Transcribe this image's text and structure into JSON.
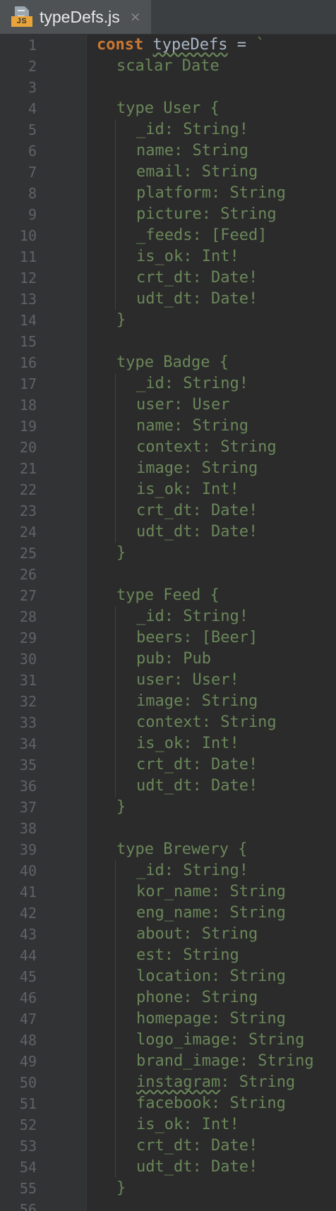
{
  "tab": {
    "icon": "js-file-icon",
    "badge": "JS",
    "title": "typeDefs.js",
    "close": "×"
  },
  "editor": {
    "lines": [
      {
        "n": "1",
        "indent": 0,
        "kw": "const",
        "id": "typeDefs",
        "op": " = ",
        "text": "`"
      },
      {
        "n": "2",
        "indent": 1,
        "text": "scalar Date"
      },
      {
        "n": "3",
        "indent": 0,
        "text": ""
      },
      {
        "n": "4",
        "indent": 1,
        "text": "type User {"
      },
      {
        "n": "5",
        "indent": 2,
        "text": "_id: String!"
      },
      {
        "n": "6",
        "indent": 2,
        "text": "name: String"
      },
      {
        "n": "7",
        "indent": 2,
        "text": "email: String"
      },
      {
        "n": "8",
        "indent": 2,
        "text": "platform: String"
      },
      {
        "n": "9",
        "indent": 2,
        "text": "picture: String"
      },
      {
        "n": "10",
        "indent": 2,
        "text": "_feeds: [Feed]"
      },
      {
        "n": "11",
        "indent": 2,
        "text": "is_ok: Int!"
      },
      {
        "n": "12",
        "indent": 2,
        "text": "crt_dt: Date!"
      },
      {
        "n": "13",
        "indent": 2,
        "text": "udt_dt: Date!"
      },
      {
        "n": "14",
        "indent": 1,
        "text": "}"
      },
      {
        "n": "15",
        "indent": 0,
        "text": ""
      },
      {
        "n": "16",
        "indent": 1,
        "text": "type Badge {"
      },
      {
        "n": "17",
        "indent": 2,
        "text": "_id: String!"
      },
      {
        "n": "18",
        "indent": 2,
        "text": "user: User"
      },
      {
        "n": "19",
        "indent": 2,
        "text": "name: String"
      },
      {
        "n": "20",
        "indent": 2,
        "text": "context: String"
      },
      {
        "n": "21",
        "indent": 2,
        "text": "image: String"
      },
      {
        "n": "22",
        "indent": 2,
        "text": "is_ok: Int!"
      },
      {
        "n": "23",
        "indent": 2,
        "text": "crt_dt: Date!"
      },
      {
        "n": "24",
        "indent": 2,
        "text": "udt_dt: Date!"
      },
      {
        "n": "25",
        "indent": 1,
        "text": "}"
      },
      {
        "n": "26",
        "indent": 0,
        "text": ""
      },
      {
        "n": "27",
        "indent": 1,
        "text": "type Feed {"
      },
      {
        "n": "28",
        "indent": 2,
        "text": "_id: String!"
      },
      {
        "n": "29",
        "indent": 2,
        "text": "beers: [Beer]"
      },
      {
        "n": "30",
        "indent": 2,
        "text": "pub: Pub"
      },
      {
        "n": "31",
        "indent": 2,
        "text": "user: User!"
      },
      {
        "n": "32",
        "indent": 2,
        "text": "image: String"
      },
      {
        "n": "33",
        "indent": 2,
        "text": "context: String"
      },
      {
        "n": "34",
        "indent": 2,
        "text": "is_ok: Int!"
      },
      {
        "n": "35",
        "indent": 2,
        "text": "crt_dt: Date!"
      },
      {
        "n": "36",
        "indent": 2,
        "text": "udt_dt: Date!"
      },
      {
        "n": "37",
        "indent": 1,
        "text": "}"
      },
      {
        "n": "38",
        "indent": 0,
        "text": ""
      },
      {
        "n": "39",
        "indent": 1,
        "text": "type Brewery {"
      },
      {
        "n": "40",
        "indent": 2,
        "text": "_id: String!"
      },
      {
        "n": "41",
        "indent": 2,
        "text": "kor_name: String"
      },
      {
        "n": "42",
        "indent": 2,
        "text": "eng_name: String"
      },
      {
        "n": "43",
        "indent": 2,
        "text": "about: String"
      },
      {
        "n": "44",
        "indent": 2,
        "text": "est: String"
      },
      {
        "n": "45",
        "indent": 2,
        "text": "location: String"
      },
      {
        "n": "46",
        "indent": 2,
        "text": "phone: String"
      },
      {
        "n": "47",
        "indent": 2,
        "text": "homepage: String"
      },
      {
        "n": "48",
        "indent": 2,
        "text": "logo_image: String"
      },
      {
        "n": "49",
        "indent": 2,
        "text": "brand_image: String"
      },
      {
        "n": "50",
        "indent": 2,
        "text": "instagram: String"
      },
      {
        "n": "51",
        "indent": 2,
        "text": "facebook: String"
      },
      {
        "n": "52",
        "indent": 2,
        "text": "is_ok: Int!"
      },
      {
        "n": "53",
        "indent": 2,
        "text": "crt_dt: Date!"
      },
      {
        "n": "54",
        "indent": 2,
        "text": "udt_dt: Date!"
      },
      {
        "n": "55",
        "indent": 1,
        "text": "}"
      },
      {
        "n": "56",
        "indent": 0,
        "text": ""
      }
    ]
  },
  "colors": {
    "background": "#2b2b2b",
    "gutter": "#313335",
    "keyword": "#cc7832",
    "identifier": "#a9b7c6",
    "string": "#6a8759",
    "line_number": "#606366"
  }
}
